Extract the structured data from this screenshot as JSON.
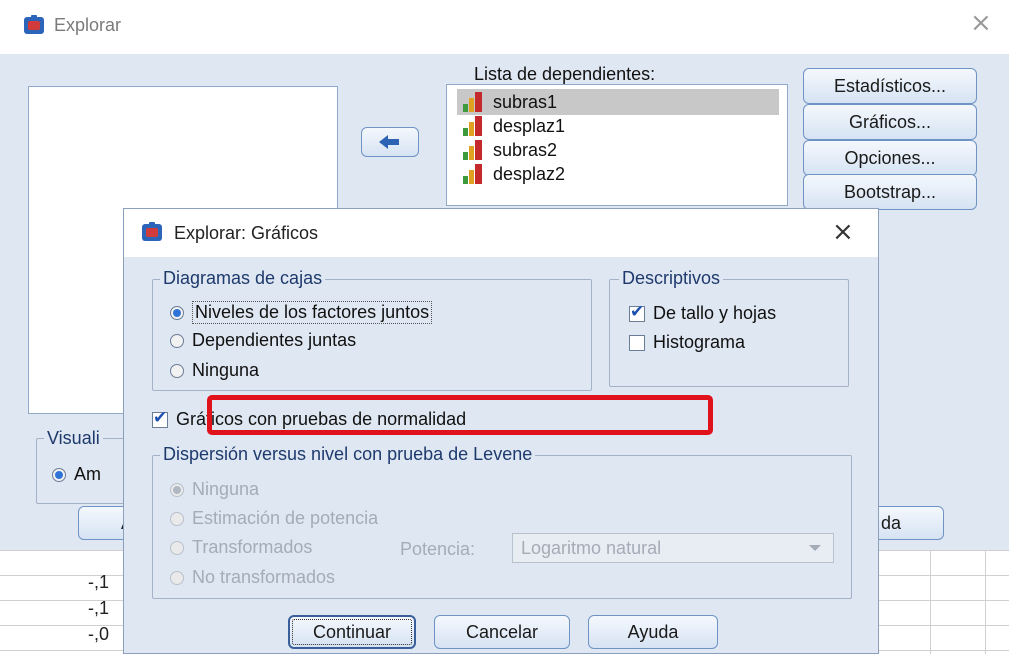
{
  "main_window": {
    "title": "Explorar",
    "close_glyph": "×",
    "dependents_label": "Lista de dependientes:",
    "dependents": [
      "subras1",
      "desplaz1",
      "subras2",
      "desplaz2"
    ],
    "buttons": {
      "estadisticos": "Estadísticos...",
      "graficos": "Gráficos...",
      "opciones": "Opciones...",
      "bootstrap": "Bootstrap..."
    },
    "visualizacion_label_partial": "Visuali",
    "ambos_partial": "Am",
    "bottom_button_right_partial": "da",
    "bottom_button_left_partial": "A",
    "data_cells": [
      "-,1",
      "-,1",
      "-,0"
    ]
  },
  "dialog": {
    "title": "Explorar: Gráficos",
    "close_glyph": "×",
    "box_group": {
      "legend": "Diagramas de cajas",
      "options": [
        {
          "label": "Niveles de los factores juntos",
          "selected": true
        },
        {
          "label": "Dependientes juntas",
          "selected": false
        },
        {
          "label": "Ninguna",
          "selected": false
        }
      ]
    },
    "descriptivos": {
      "legend": "Descriptivos",
      "options": [
        {
          "label": "De tallo y hojas",
          "checked": true
        },
        {
          "label": "Histograma",
          "checked": false
        }
      ]
    },
    "normality": {
      "label": "Gráficos con pruebas de normalidad",
      "checked": true
    },
    "levene": {
      "legend": "Dispersión versus nivel con prueba de Levene",
      "options": [
        {
          "label": "Ninguna",
          "selected": true
        },
        {
          "label": "Estimación de potencia",
          "selected": false
        },
        {
          "label": "Transformados",
          "selected": false
        },
        {
          "label": "No transformados",
          "selected": false
        }
      ],
      "potencia_label": "Potencia:",
      "potencia_value": "Logaritmo natural"
    },
    "buttons": {
      "continuar": "Continuar",
      "cancelar": "Cancelar",
      "ayuda": "Ayuda"
    }
  },
  "colors": {
    "highlight": "#e0121b",
    "panel_bg": "#dfe7f2",
    "button_border": "#6f93c4",
    "accent": "#2d74d6"
  }
}
